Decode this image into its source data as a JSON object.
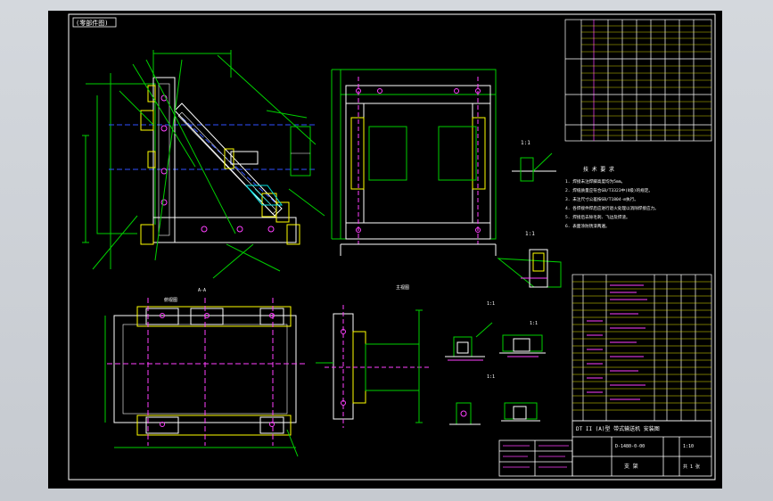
{
  "drawing": {
    "top_left_tag": "(零部件图)",
    "view_label_left": "A-A",
    "view_label_mid": "主视图",
    "view_label_bottom": "俯视图",
    "detail_labels": [
      "1:1",
      "1:1",
      "1:1",
      "1:1",
      "1:1"
    ],
    "tech_req_title": "技 术 要 求",
    "tech_req_lines": [
      "1. 焊接未注焊脚高度均为5mm。",
      "2. 焊缝质量应符合GB/T3323中(Ⅱ级)的规定。",
      "3. 未注尺寸公差按GB/T1804-m执行。",
      "4. 各焊接件焊后应进行退火处理以消除焊接应力。",
      "5. 焊接后去除毛刺、飞边及焊渣。",
      "6. 表面涂防锈漆两遍。"
    ],
    "title_block": {
      "title": "DT II (A)型 带式输送机 安装图",
      "code": "D-1480-0-00",
      "scale": "1:10",
      "sheet": "共 1 张",
      "name": "支 架"
    }
  }
}
